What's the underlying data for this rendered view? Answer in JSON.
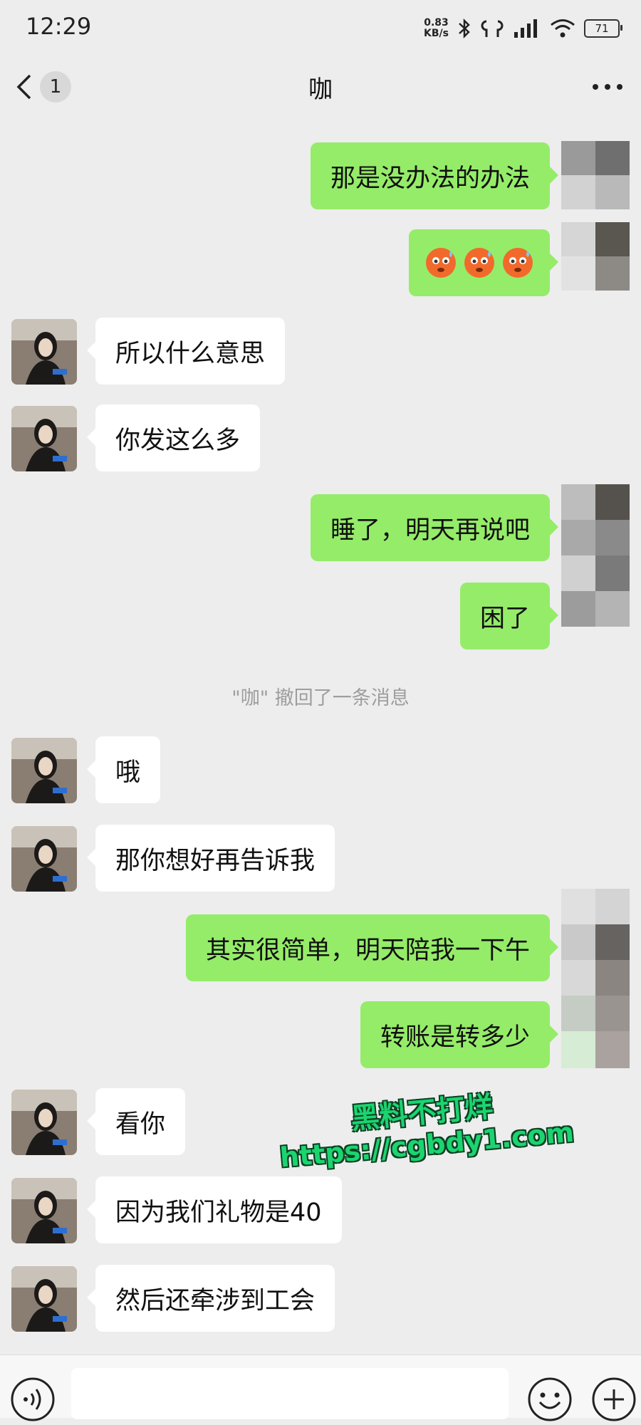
{
  "status_bar": {
    "time": "12:29",
    "net_speed_value": "0.83",
    "net_speed_unit": "KB/s",
    "battery": "71"
  },
  "header": {
    "unread_count": "1",
    "title": "咖"
  },
  "messages": [
    {
      "side": "me",
      "text": "那是没办法的办法"
    },
    {
      "side": "me",
      "emojis": [
        "cold-sweat-emoji",
        "cold-sweat-emoji",
        "cold-sweat-emoji"
      ]
    },
    {
      "side": "them",
      "text": "所以什么意思"
    },
    {
      "side": "them",
      "text": "你发这么多"
    },
    {
      "side": "me",
      "text": "睡了，明天再说吧"
    },
    {
      "side": "me",
      "text": "困了"
    },
    {
      "side": "them",
      "text": "哦"
    },
    {
      "side": "them",
      "text": "那你想好再告诉我"
    },
    {
      "side": "me",
      "text": "其实很简单，明天陪我一下午"
    },
    {
      "side": "me",
      "text": "转账是转多少"
    },
    {
      "side": "them",
      "text": "看你"
    },
    {
      "side": "them",
      "text": "因为我们礼物是40"
    },
    {
      "side": "them",
      "text": "然后还牵涉到工会"
    }
  ],
  "system_notice": "\"咖\" 撤回了一条消息",
  "watermark": {
    "line1": "黑料不打烊",
    "line2": "https://cgbdy1.com"
  },
  "colors": {
    "background": "#ededed",
    "my_bubble": "#95ec69",
    "their_bubble": "#ffffff",
    "watermark": "#1bd470"
  },
  "icons": [
    "back-chevron-icon",
    "more-dots-icon",
    "voice-icon",
    "emoji-icon",
    "plus-icon",
    "bluetooth-icon",
    "earbuds-icon",
    "signal-icon",
    "wifi-icon",
    "battery-icon"
  ]
}
